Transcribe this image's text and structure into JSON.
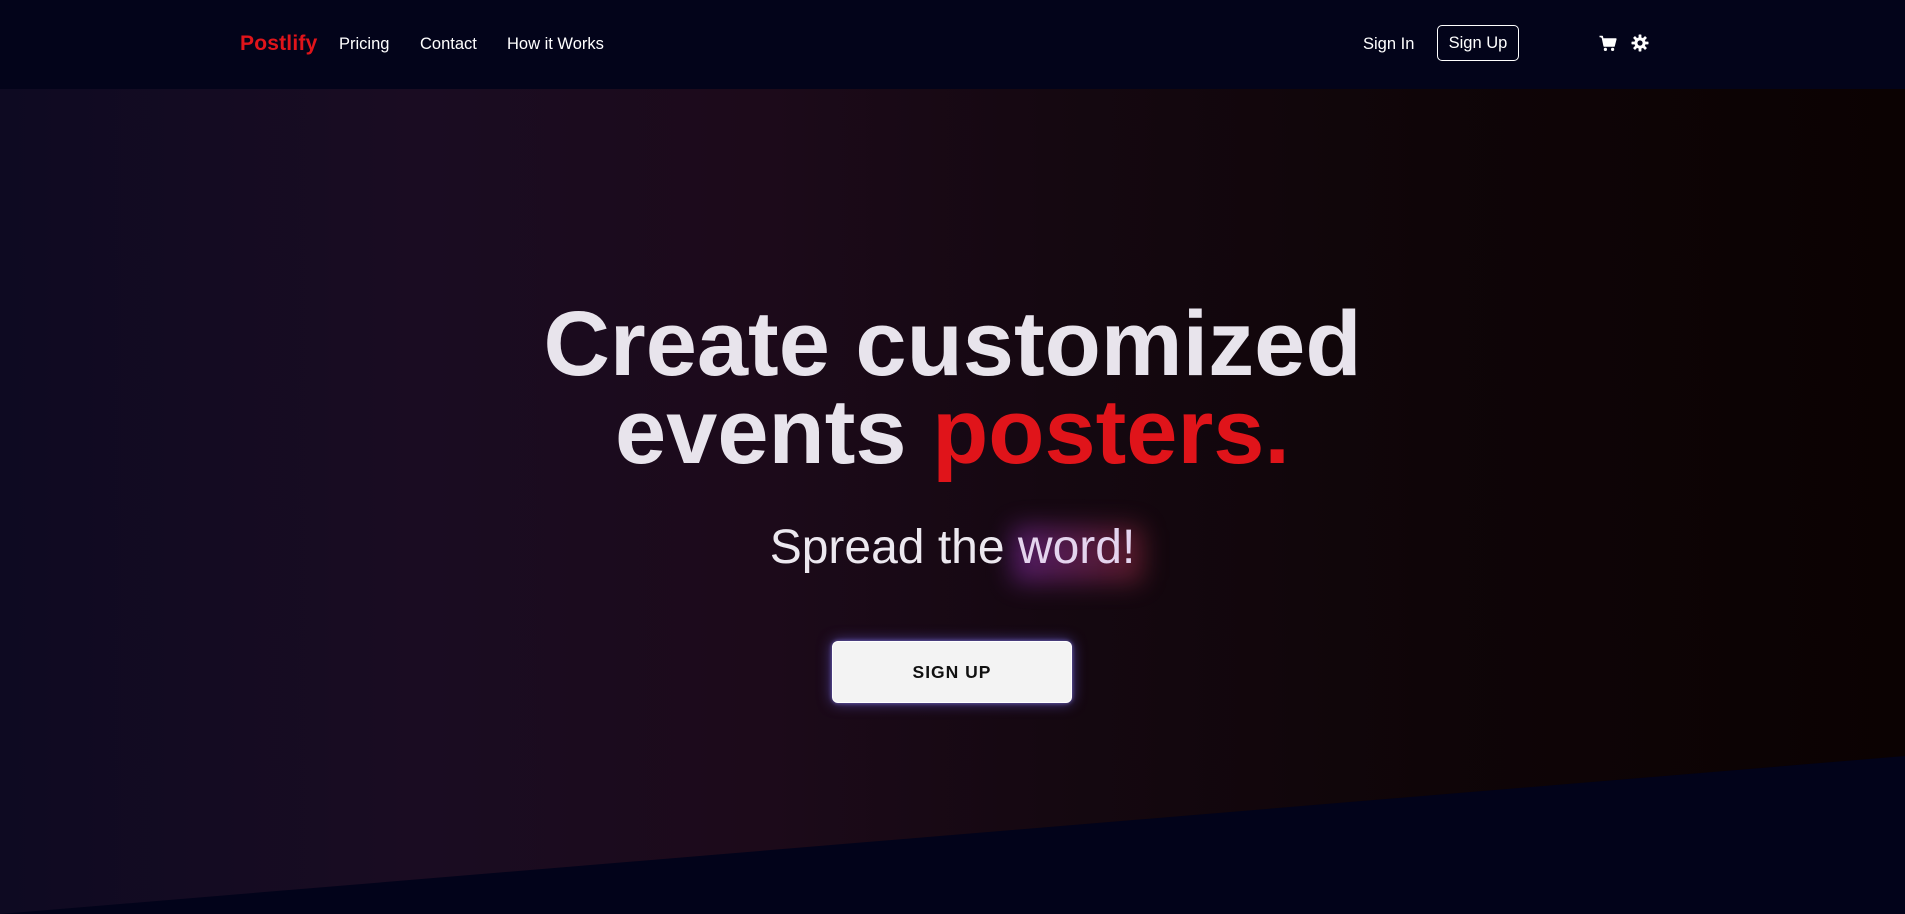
{
  "nav": {
    "brand": "Postlify",
    "links": [
      "Pricing",
      "Contact",
      "How it Works"
    ],
    "sign_in": "Sign In",
    "sign_up": "Sign Up",
    "cart_icon": "cart-icon",
    "theme_icon": "sun-gear-icon"
  },
  "hero": {
    "headline_line1": "Create customized",
    "headline_line2_plain": "events ",
    "headline_line2_accent": "posters.",
    "subline_plain": "Spread the ",
    "subline_glow": "word!",
    "cta_label": "SIGN UP"
  },
  "colors": {
    "accent": "#e0141a",
    "nav_bg": "#03041a",
    "text": "#e8e4ec",
    "cta_bg": "#f3f3f3"
  }
}
